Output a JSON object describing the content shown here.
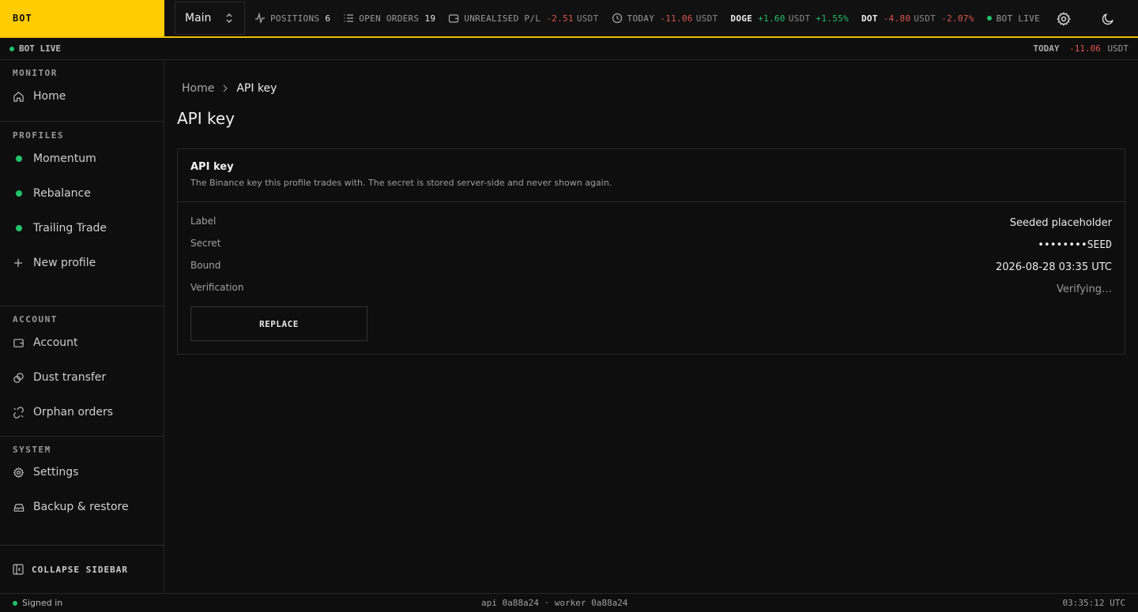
{
  "brand": "BOT",
  "profile_select": {
    "value": "Main"
  },
  "stats": {
    "positions_label": "POSITIONS",
    "positions_value": "6",
    "orders_label": "OPEN ORDERS",
    "orders_value": "19",
    "upl_label": "UNREALISED P/L",
    "upl_value": "-2.51",
    "upl_unit": "USDT",
    "today_label": "TODAY",
    "today_value": "-11.06",
    "today_unit": "USDT",
    "doge_sym": "DOGE",
    "doge_value": "+1.60",
    "doge_unit": "USDT",
    "doge_pct": "+1.55%",
    "dot_sym": "DOT",
    "dot_value": "-4.80",
    "dot_unit": "USDT",
    "dot_pct": "-2.07%",
    "live_label": "BOT LIVE"
  },
  "strip": {
    "live": "BOT LIVE",
    "today_label": "TODAY",
    "today_value": "-11.06",
    "today_unit": "USDT"
  },
  "sidebar": {
    "monitor_head": "MONITOR",
    "home": "Home",
    "profiles_head": "PROFILES",
    "profiles": [
      "Momentum",
      "Rebalance",
      "Trailing Trade"
    ],
    "new_profile": "New profile",
    "account_head": "ACCOUNT",
    "account": "Account",
    "dust": "Dust transfer",
    "orphan": "Orphan orders",
    "system_head": "SYSTEM",
    "settings": "Settings",
    "backup": "Backup & restore",
    "collapse": "COLLAPSE SIDEBAR"
  },
  "breadcrumb": {
    "home": "Home",
    "current": "API key"
  },
  "page_title": "API key",
  "card": {
    "title": "API key",
    "desc": "The Binance key this profile trades with. The secret is stored server-side and never shown again.",
    "label_k": "Label",
    "label_v": "Seeded placeholder",
    "secret_k": "Secret",
    "secret_v": "••••••••SEED",
    "bound_k": "Bound",
    "bound_v": "2026-08-28 03:35 UTC",
    "verif_k": "Verification",
    "verif_v": "Verifying…",
    "replace": "REPLACE"
  },
  "footer": {
    "signed": "Signed in",
    "build": "api 0a88a24 · worker 0a88a24",
    "clock": "03:35:12 UTC"
  },
  "colors": {
    "accent": "#ffcc00",
    "positive": "#23c26b",
    "negative": "#e0554d"
  }
}
